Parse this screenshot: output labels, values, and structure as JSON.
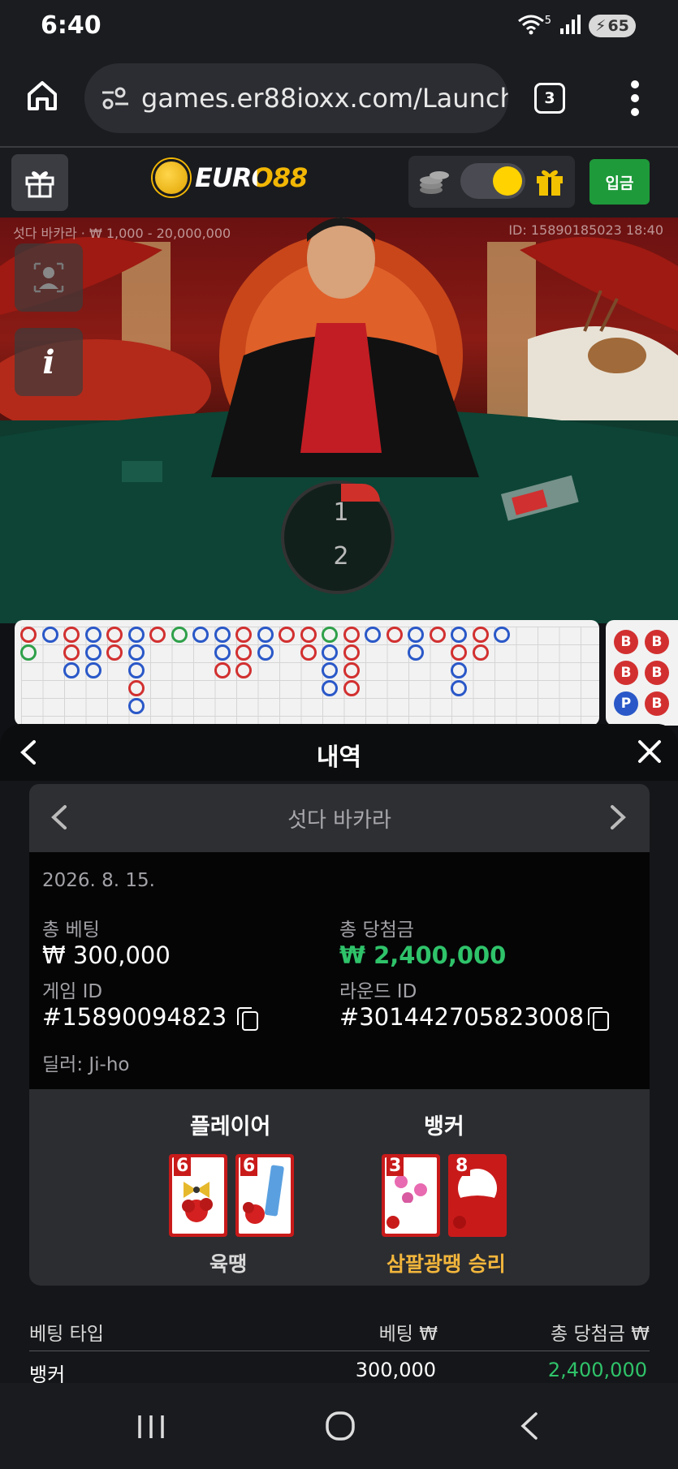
{
  "status_bar": {
    "time": "6:40",
    "wifi_badge": "5",
    "battery": "65"
  },
  "browser": {
    "url": "games.er88ioxx.com/Launch",
    "tab_count": "3"
  },
  "site": {
    "logo_text": "EURO88",
    "deposit_label": "입금"
  },
  "video": {
    "table_info": "섯다 바카라 · ₩ 1,000 - 20,000,000",
    "round_info": "ID: 15890185023 18:40",
    "timer_top": "1",
    "timer_bottom": "2"
  },
  "road": {
    "beads": [
      "B",
      "B",
      "B",
      "B",
      "P",
      "B"
    ]
  },
  "panel": {
    "title": "내역",
    "game_name": "섯다 바카라",
    "date": "2026. 8. 15.",
    "total_bet_label": "총 베팅",
    "total_bet_value": "₩ 300,000",
    "total_win_label": "총 당첨금",
    "total_win_value": "₩ 2,400,000",
    "game_id_label": "게임 ID",
    "game_id_value": "#15890094823",
    "round_id_label": "라운드 ID",
    "round_id_value": "#301442705823008",
    "dealer": "딜러: Ji-ho",
    "player": {
      "title": "플레이어",
      "cards": [
        "6",
        "6"
      ],
      "result": "육땡"
    },
    "banker": {
      "title": "뱅커",
      "cards": [
        "3",
        "8"
      ],
      "result": "삼팔광땡 승리"
    },
    "table": {
      "headers": [
        "베팅 타입",
        "베팅 ₩",
        "총 당첨금 ₩"
      ],
      "rows": [
        {
          "type": "뱅커",
          "bet": "300,000",
          "win": "2,400,000"
        }
      ]
    }
  },
  "colors": {
    "win_green": "#2fc36a",
    "gold": "#f2b63c",
    "banker_red": "#d23030",
    "player_blue": "#2a58c8",
    "deposit_green": "#1e9a3a"
  }
}
